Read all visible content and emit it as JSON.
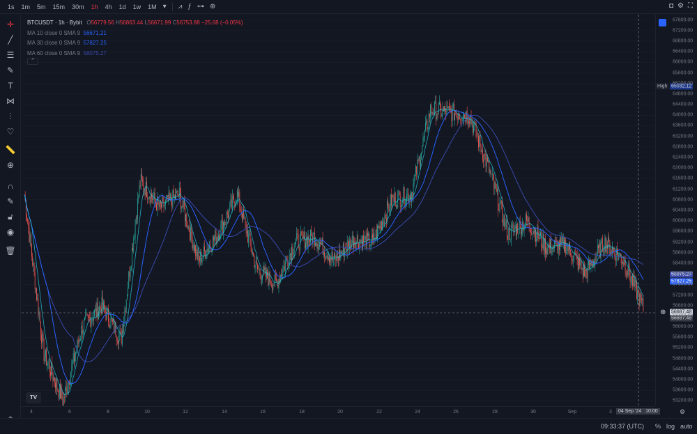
{
  "toolbar": {
    "timeframes": [
      "1s",
      "1m",
      "5m",
      "15m",
      "30m",
      "1h",
      "4h",
      "1d",
      "1w",
      "1M"
    ],
    "active_timeframe": "1h"
  },
  "legend": {
    "symbol": "BTCUSDT · 1h · Bybit",
    "open_label": "O",
    "open": "56779.56",
    "high_label": "H",
    "high": "56863.44",
    "low_label": "L",
    "low": "56671.99",
    "close_label": "C",
    "close": "56753.88",
    "change": "−25.68 (−0.05%)",
    "ma10_label": "MA 10 close 0 SMA 9",
    "ma10_value": "56671.21",
    "ma30_label": "MA 30 close 0 SMA 9",
    "ma30_value": "57827.25",
    "ma60_label": "MA 60 close 0 SMA 9",
    "ma60_value": "58075.27"
  },
  "price_axis": {
    "ticks": [
      "67600.00",
      "67200.00",
      "66800.00",
      "66400.00",
      "66000.00",
      "65600.00",
      "65200.00",
      "64800.00",
      "64400.00",
      "64000.00",
      "63600.00",
      "63200.00",
      "62800.00",
      "62400.00",
      "62000.00",
      "61600.00",
      "61200.00",
      "60800.00",
      "60400.00",
      "60000.00",
      "59600.00",
      "59200.00",
      "58800.00",
      "58400.00",
      "58000.00",
      "57600.00",
      "57200.00",
      "56800.00",
      "56400.00",
      "56000.00",
      "55600.00",
      "55200.00",
      "54800.00",
      "54400.00",
      "54000.00",
      "53600.00",
      "53200.00"
    ],
    "high_tag": "High",
    "high_value": "65032.12",
    "ma60_tag": "58075.27",
    "ma30_tag": "57827.25",
    "crosshair_value": "56687.48",
    "last_price": "56667.48"
  },
  "time_axis": {
    "labels": [
      "4",
      "6",
      "8",
      "10",
      "12",
      "14",
      "16",
      "18",
      "20",
      "22",
      "24",
      "26",
      "28",
      "30",
      "Sep",
      "3"
    ],
    "cursor_label": "04 Sep '24",
    "cursor_hour": "10:00"
  },
  "bottom": {
    "clock": "09:33:37 (UTC)",
    "percent": "%",
    "log": "log",
    "auto": "auto"
  },
  "logo_text": "TV",
  "colors": {
    "background": "#131722",
    "up": "#26a69a",
    "down": "#ef5350",
    "ma10": "#26c6da",
    "ma30": "#2962ff",
    "ma60": "#3949ab",
    "accent": "#2962ff"
  },
  "chart_data": {
    "type": "candlestick",
    "interval": "1h",
    "x_range": [
      "2024-08-03",
      "2024-09-04"
    ],
    "ylim": [
      53000,
      67800
    ],
    "price_path": [
      {
        "x": "Aug 4",
        "y": 61000
      },
      {
        "x": "Aug 5",
        "y": 55000
      },
      {
        "x": "Aug 5",
        "y": 53200
      },
      {
        "x": "Aug 6",
        "y": 56000
      },
      {
        "x": "Aug 7",
        "y": 56800
      },
      {
        "x": "Aug 8",
        "y": 55500
      },
      {
        "x": "Aug 9",
        "y": 61500
      },
      {
        "x": "Aug 10",
        "y": 60500
      },
      {
        "x": "Aug 11",
        "y": 61000
      },
      {
        "x": "Aug 12",
        "y": 58500
      },
      {
        "x": "Aug 13",
        "y": 59500
      },
      {
        "x": "Aug 14",
        "y": 61000
      },
      {
        "x": "Aug 15",
        "y": 58200
      },
      {
        "x": "Aug 16",
        "y": 57600
      },
      {
        "x": "Aug 17",
        "y": 59200
      },
      {
        "x": "Aug 18",
        "y": 59400
      },
      {
        "x": "Aug 19",
        "y": 58500
      },
      {
        "x": "Aug 20",
        "y": 59300
      },
      {
        "x": "Aug 21",
        "y": 59200
      },
      {
        "x": "Aug 22",
        "y": 60800
      },
      {
        "x": "Aug 23",
        "y": 61000
      },
      {
        "x": "Aug 24",
        "y": 64200
      },
      {
        "x": "Aug 25",
        "y": 64100
      },
      {
        "x": "Aug 26",
        "y": 64000
      },
      {
        "x": "Aug 27",
        "y": 62000
      },
      {
        "x": "Aug 28",
        "y": 59500
      },
      {
        "x": "Aug 29",
        "y": 60000
      },
      {
        "x": "Aug 30",
        "y": 59000
      },
      {
        "x": "Aug 31",
        "y": 59100
      },
      {
        "x": "Sep 1",
        "y": 58000
      },
      {
        "x": "Sep 2",
        "y": 59200
      },
      {
        "x": "Sep 3",
        "y": 58500
      },
      {
        "x": "Sep 4",
        "y": 56700
      }
    ],
    "session_high": 65032.12,
    "last": 56667.48,
    "ma10": 56671.21,
    "ma30": 57827.25,
    "ma60": 58075.27
  }
}
